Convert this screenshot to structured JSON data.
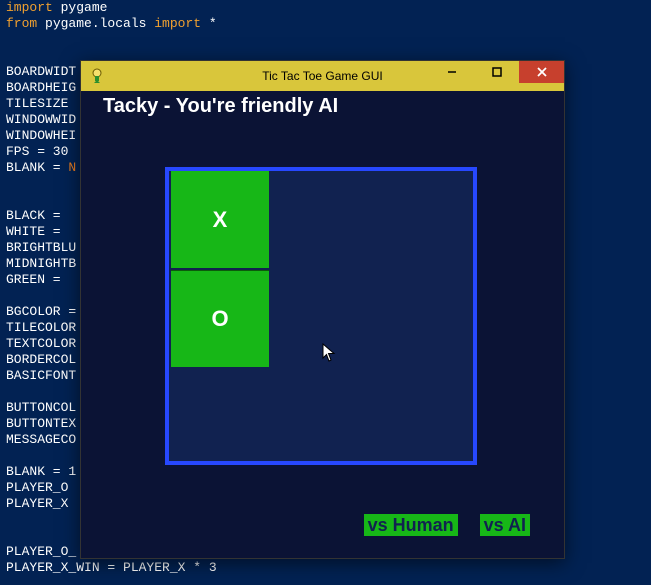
{
  "code_lines": [
    [
      [
        "kw-orange",
        "import"
      ],
      [
        "kw-white",
        " pygame"
      ]
    ],
    [
      [
        "kw-orange",
        "from"
      ],
      [
        "kw-white",
        " pygame.locals "
      ],
      [
        "kw-orange",
        "import"
      ],
      [
        "kw-white",
        " *"
      ]
    ],
    [],
    [],
    [
      [
        "kw-white",
        "BOARDWIDT"
      ]
    ],
    [
      [
        "kw-white",
        "BOARDHEIG"
      ]
    ],
    [
      [
        "kw-white",
        "TILESIZE "
      ]
    ],
    [
      [
        "kw-white",
        "WINDOWWID"
      ]
    ],
    [
      [
        "kw-white",
        "WINDOWHEI"
      ]
    ],
    [
      [
        "kw-white",
        "FPS = 30"
      ]
    ],
    [
      [
        "kw-white",
        "BLANK = "
      ],
      [
        "kw-hlnone",
        "N"
      ]
    ],
    [],
    [],
    [
      [
        "kw-white",
        "BLACK = "
      ]
    ],
    [
      [
        "kw-white",
        "WHITE = "
      ]
    ],
    [
      [
        "kw-white",
        "BRIGHTBLU"
      ]
    ],
    [
      [
        "kw-white",
        "MIDNIGHTB"
      ]
    ],
    [
      [
        "kw-white",
        "GREEN = "
      ]
    ],
    [],
    [
      [
        "kw-white",
        "BGCOLOR ="
      ]
    ],
    [
      [
        "kw-white",
        "TILECOLOR"
      ]
    ],
    [
      [
        "kw-white",
        "TEXTCOLOR"
      ]
    ],
    [
      [
        "kw-white",
        "BORDERCOL"
      ]
    ],
    [
      [
        "kw-white",
        "BASICFONT"
      ]
    ],
    [],
    [
      [
        "kw-white",
        "BUTTONCOL"
      ]
    ],
    [
      [
        "kw-white",
        "BUTTONTEX"
      ]
    ],
    [
      [
        "kw-white",
        "MESSAGECO"
      ]
    ],
    [],
    [
      [
        "kw-white",
        "BLANK = 1"
      ]
    ],
    [
      [
        "kw-white",
        "PLAYER_O "
      ]
    ],
    [
      [
        "kw-white",
        "PLAYER_X "
      ]
    ],
    [],
    [],
    [
      [
        "kw-white",
        "PLAYER_O_"
      ]
    ],
    [
      [
        "kw-white",
        "PLAYER_X_WIN = PLAYER_X * 3"
      ]
    ]
  ],
  "window": {
    "title": "Tic Tac Toe Game GUI"
  },
  "game": {
    "heading": "Tacky - You're friendly AI",
    "tiles": [
      "X",
      "O"
    ],
    "mode_human": "vs Human",
    "mode_ai": "vs AI"
  }
}
